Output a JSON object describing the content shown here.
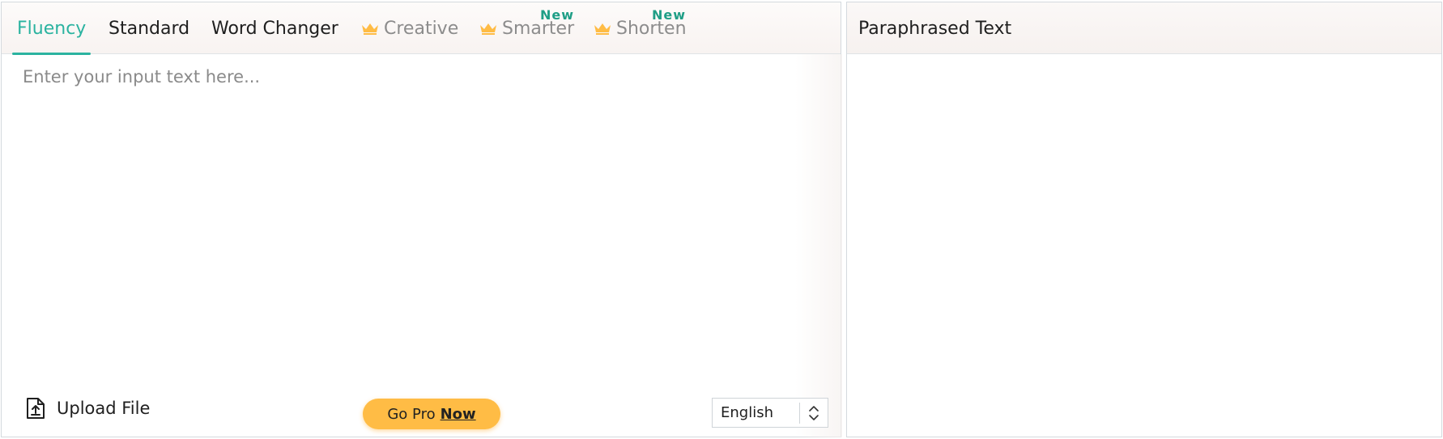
{
  "tabs": [
    {
      "label": "Fluency",
      "active": true,
      "pro": false,
      "is_new": false
    },
    {
      "label": "Standard",
      "active": false,
      "pro": false,
      "is_new": false
    },
    {
      "label": "Word Changer",
      "active": false,
      "pro": false,
      "is_new": false
    },
    {
      "label": "Creative",
      "active": false,
      "pro": true,
      "is_new": false
    },
    {
      "label": "Smarter",
      "active": false,
      "pro": true,
      "is_new": true
    },
    {
      "label": "Shorten",
      "active": false,
      "pro": true,
      "is_new": true
    }
  ],
  "new_badge": "New",
  "input": {
    "placeholder": "Enter your input text here...",
    "value": ""
  },
  "upload": {
    "label": "Upload File",
    "icon": "upload-file-icon"
  },
  "gopro": {
    "label": "Go Pro",
    "emphasis": "Now"
  },
  "language": {
    "selected": "English"
  },
  "output": {
    "title": "Paraphrased Text"
  },
  "colors": {
    "accent": "#2bb3a0",
    "crown": "#ffbc45",
    "button": "#ffbc45",
    "new_badge": "#1f9e86"
  }
}
